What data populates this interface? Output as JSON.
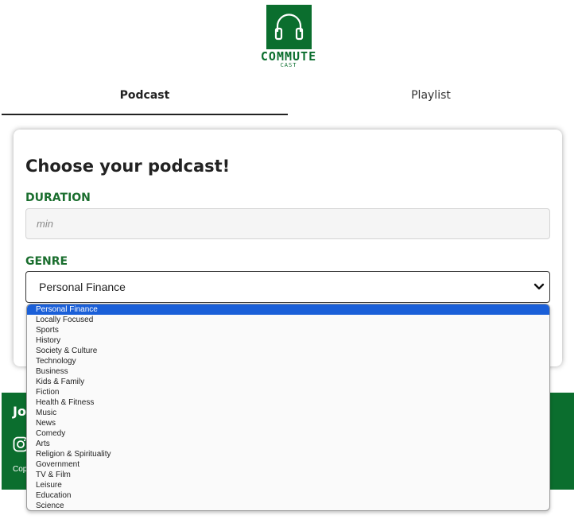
{
  "logo": {
    "title": "COMMUTE",
    "subtitle": "CAST",
    "icon": "headphones-icon",
    "brand_color": "#0b6e2e"
  },
  "tabs": [
    {
      "label": "Podcast",
      "active": true
    },
    {
      "label": "Playlist",
      "active": false
    }
  ],
  "card": {
    "title": "Choose your podcast!",
    "duration_label": "DURATION",
    "duration_placeholder": "min",
    "genre_label": "GENRE",
    "genre_selected": "Personal Finance"
  },
  "footer": {
    "title": "Jo",
    "copyright": "Cop",
    "icon": "instagram-icon"
  },
  "genre_options": [
    "Personal Finance",
    "Locally Focused",
    "Sports",
    "History",
    "Society & Culture",
    "Technology",
    "Business",
    "Kids & Family",
    "Fiction",
    "Health & Fitness",
    "Music",
    "News",
    "Comedy",
    "Arts",
    "Religion & Spirituality",
    "Government",
    "TV & Film",
    "Leisure",
    "Education",
    "Science"
  ],
  "colors": {
    "accent_green": "#0b6e2e",
    "label_green": "#1a6e2e",
    "selection_blue": "#1a5fd8"
  }
}
